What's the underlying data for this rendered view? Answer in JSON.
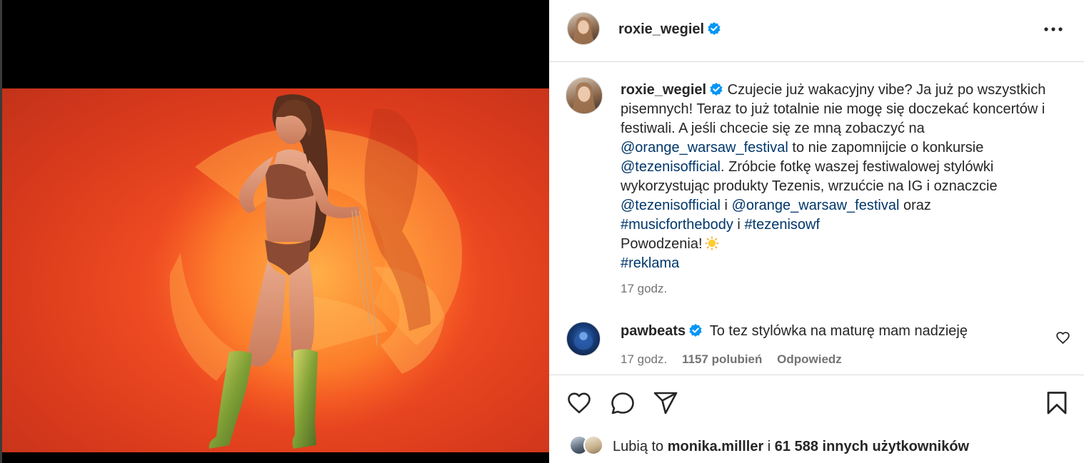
{
  "post": {
    "author": "roxie_wegiel",
    "verified": true,
    "more_icon": "more-horizontal-icon"
  },
  "caption": {
    "username": "roxie_wegiel",
    "text_1": "Czujecie już wakacyjny vibe? Ja już po wszystkich pisemnych! Teraz to już totalnie nie mogę się doczekać koncertów i festiwali. A jeśli chcecie się ze mną zobaczyć na ",
    "mention_1": "@orange_warsaw_festival",
    "text_2": " to nie zapomnijcie o konkursie ",
    "mention_2": "@tezenisofficial",
    "text_3": ". Zróbcie fotkę waszej festiwalowej stylówki wykorzystując produkty Tezenis, wrzućcie na IG i oznaczcie ",
    "mention_3": "@tezenisofficial",
    "text_4": " i ",
    "mention_4": "@orange_warsaw_festival",
    "text_5": " oraz",
    "hashtag_1": "#musicforthebody",
    "text_6": " i ",
    "hashtag_2": "#tezenisowf",
    "text_7": "Powodzenia!",
    "emoji": "sun-emoji",
    "hashtag_3": "#reklama",
    "time": "17 godz."
  },
  "comment": {
    "username": "pawbeats",
    "verified": true,
    "text": "To tez stylówka na maturę mam nadzieję",
    "time": "17 godz.",
    "likes": "1157 polubień",
    "reply": "Odpowiedz"
  },
  "actions": {
    "like_icon": "heart-icon",
    "comment_icon": "comment-icon",
    "share_icon": "share-icon",
    "save_icon": "bookmark-icon"
  },
  "likes": {
    "prefix": "Lubią to ",
    "user": "monika.milller",
    "middle": " i ",
    "count": "61 588 innych użytkowników"
  },
  "colors": {
    "text": "#262626",
    "secondary": "#737373",
    "link": "#00376b",
    "verified": "#0095f6",
    "divider": "#dbdbdb",
    "photo_background": "#e8481f"
  }
}
